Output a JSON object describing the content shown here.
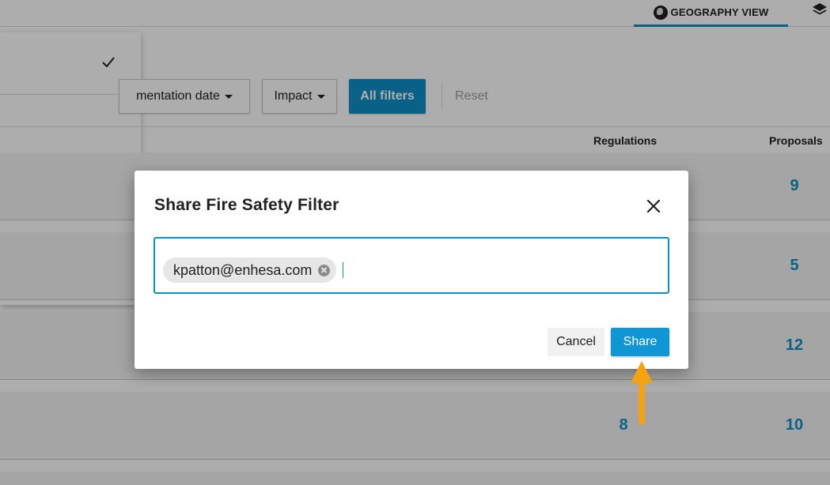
{
  "header": {
    "geography_tab": "GEOGRAPHY VIEW"
  },
  "filters": {
    "implementation_date": "mentation date",
    "impact": "Impact",
    "all_filters": "All filters",
    "reset": "Reset"
  },
  "table": {
    "columns": {
      "regulations": "Regulations",
      "proposals": "Proposals"
    },
    "rows": [
      {
        "regulations": "",
        "proposals": "9"
      },
      {
        "regulations": "",
        "proposals": "5"
      },
      {
        "regulations": "",
        "proposals": "12"
      },
      {
        "regulations": "8",
        "proposals": "10"
      }
    ]
  },
  "modal": {
    "title": "Share Fire Safety Filter",
    "recipient_chip": "kpatton@enhesa.com",
    "input_value": "",
    "cancel_label": "Cancel",
    "share_label": "Share"
  },
  "colors": {
    "accent": "#0f8fc8",
    "share_button": "#0f96d4",
    "annotation_arrow": "#f5a410"
  },
  "icons": {
    "globe": "globe-icon",
    "layers": "layers-icon",
    "check": "check-icon",
    "close": "close-icon",
    "chip_remove": "remove-chip-icon",
    "annotation": "arrow-up-annotation"
  }
}
